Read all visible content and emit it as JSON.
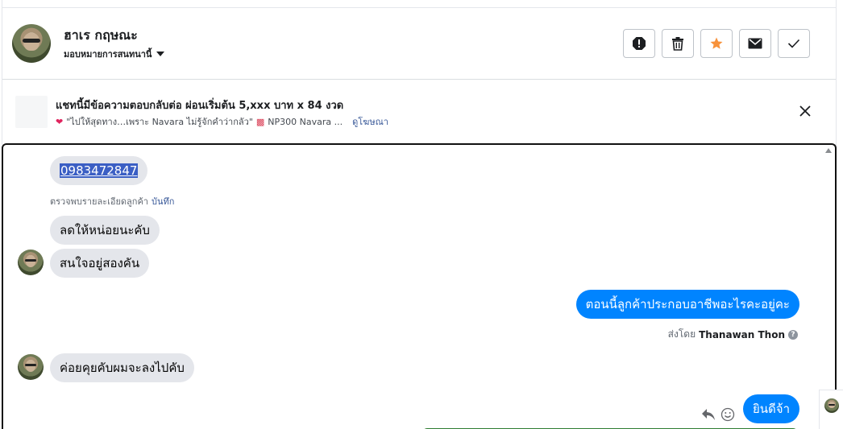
{
  "header": {
    "contact_name": "ฮาเร กฤษณะ",
    "assign_label": "มอบหมายการสนทนานี้",
    "actions": [
      "exclamation-icon",
      "trash-icon",
      "star-icon",
      "envelope-icon",
      "check-icon"
    ],
    "star_color": "#f7923b"
  },
  "banner": {
    "title": "แชทนี้มีข้อความตอบกลับต่อ ผ่อนเริ่มต้น 5,xxx บาท x 84 งวด",
    "subtitle": "\"ไปให้สุดทาง…เพราะ Navara ไม่รู้จักคำว่ากลัว\"",
    "subtitle_tail": "NP300 Navara ...",
    "link": "ดูโฆษณา"
  },
  "chat": {
    "phone": "0983472847",
    "detected_note": "ตรวจพบรายละเอียดลูกค้า",
    "save_link": "บันทึก",
    "messages": [
      {
        "dir": "in",
        "text": "ลดให้หน่อยนะคับ"
      },
      {
        "dir": "in",
        "text": "สนใจอยู่สองคัน"
      },
      {
        "dir": "out",
        "text": "ตอนนี้ลูกค้าประกอบอาชีพอะไรคะอยู่คะ"
      },
      {
        "dir": "in",
        "text": "ค่อยคุยคับผมจะลงไปคับ"
      },
      {
        "dir": "out",
        "text": "ยินดีจ้า"
      }
    ],
    "sent_by_prefix": "ส่งโดย",
    "sent_by_name": "Thanawan Thon",
    "help_glyph": "?",
    "outgoing_color": "#0084ff",
    "incoming_color": "#e4e6eb"
  }
}
